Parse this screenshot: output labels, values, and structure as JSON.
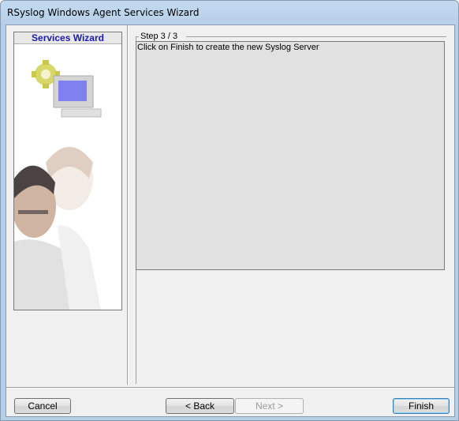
{
  "window": {
    "title": "RSyslog Windows Agent Services Wizard"
  },
  "left_panel": {
    "header": "Services Wizard"
  },
  "step": {
    "label": "Step 3 / 3",
    "message": "Click on Finish to create the new Syslog Server"
  },
  "buttons": {
    "cancel": "Cancel",
    "back": "< Back",
    "next": "Next >",
    "finish": "Finish"
  }
}
